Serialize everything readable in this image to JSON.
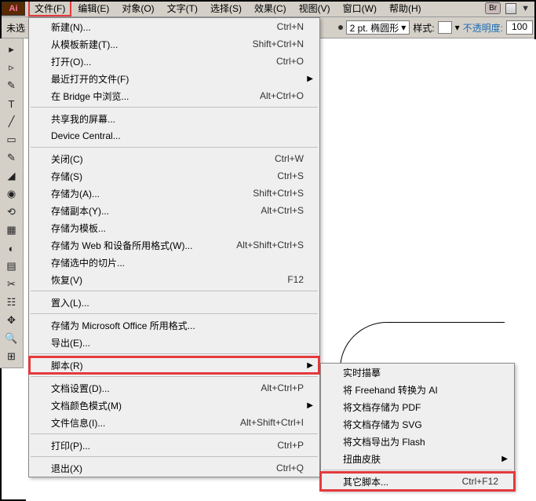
{
  "menubar": {
    "logo": "Ai",
    "items": [
      "文件(F)",
      "编辑(E)",
      "对象(O)",
      "文字(T)",
      "选择(S)",
      "效果(C)",
      "视图(V)",
      "窗口(W)",
      "帮助(H)"
    ],
    "br": "Br"
  },
  "toolbar": {
    "unsel": "未选",
    "stroke": "2 pt. 椭圆形",
    "style_label": "样式:",
    "opacity_label": "不透明度:",
    "opacity_value": "100"
  },
  "file_menu": [
    {
      "label": "新建(N)...",
      "sc": "Ctrl+N"
    },
    {
      "label": "从模板新建(T)...",
      "sc": "Shift+Ctrl+N"
    },
    {
      "label": "打开(O)...",
      "sc": "Ctrl+O"
    },
    {
      "label": "最近打开的文件(F)",
      "sc": "",
      "sub": true
    },
    {
      "label": "在 Bridge 中浏览...",
      "sc": "Alt+Ctrl+O"
    },
    {
      "sep": true
    },
    {
      "label": "共享我的屏幕...",
      "sc": ""
    },
    {
      "label": "Device Central...",
      "sc": ""
    },
    {
      "sep": true
    },
    {
      "label": "关闭(C)",
      "sc": "Ctrl+W"
    },
    {
      "label": "存储(S)",
      "sc": "Ctrl+S"
    },
    {
      "label": "存储为(A)...",
      "sc": "Shift+Ctrl+S"
    },
    {
      "label": "存储副本(Y)...",
      "sc": "Alt+Ctrl+S"
    },
    {
      "label": "存储为模板...",
      "sc": ""
    },
    {
      "label": "存储为 Web 和设备所用格式(W)...",
      "sc": "Alt+Shift+Ctrl+S"
    },
    {
      "label": "存储选中的切片...",
      "sc": ""
    },
    {
      "label": "恢复(V)",
      "sc": "F12"
    },
    {
      "sep": true
    },
    {
      "label": "置入(L)...",
      "sc": ""
    },
    {
      "sep": true
    },
    {
      "label": "存储为 Microsoft Office 所用格式...",
      "sc": ""
    },
    {
      "label": "导出(E)...",
      "sc": ""
    },
    {
      "sep": true
    },
    {
      "label": "脚本(R)",
      "sc": "",
      "sub": true,
      "hl": true
    },
    {
      "sep": true
    },
    {
      "label": "文档设置(D)...",
      "sc": "Alt+Ctrl+P"
    },
    {
      "label": "文档颜色模式(M)",
      "sc": "",
      "sub": true
    },
    {
      "label": "文件信息(I)...",
      "sc": "Alt+Shift+Ctrl+I"
    },
    {
      "sep": true
    },
    {
      "label": "打印(P)...",
      "sc": "Ctrl+P"
    },
    {
      "sep": true
    },
    {
      "label": "退出(X)",
      "sc": "Ctrl+Q"
    }
  ],
  "submenu": [
    {
      "label": "实时描摹",
      "sc": ""
    },
    {
      "label": "将 Freehand 转换为 AI",
      "sc": ""
    },
    {
      "label": "将文档存储为 PDF",
      "sc": ""
    },
    {
      "label": "将文档存储为 SVG",
      "sc": ""
    },
    {
      "label": "将文档导出为 Flash",
      "sc": ""
    },
    {
      "label": "扭曲皮肤",
      "sc": "",
      "sub": true
    },
    {
      "sep": true
    },
    {
      "label": "其它脚本...",
      "sc": "Ctrl+F12",
      "hl": true
    }
  ],
  "tools": [
    "▸",
    "▹",
    "✎",
    "T",
    "╱",
    "▭",
    "✎",
    "◢",
    "◉",
    "⟲",
    "▦",
    "◐",
    "▤",
    "✂",
    "☷",
    "✥",
    "🔍",
    "⊞"
  ]
}
